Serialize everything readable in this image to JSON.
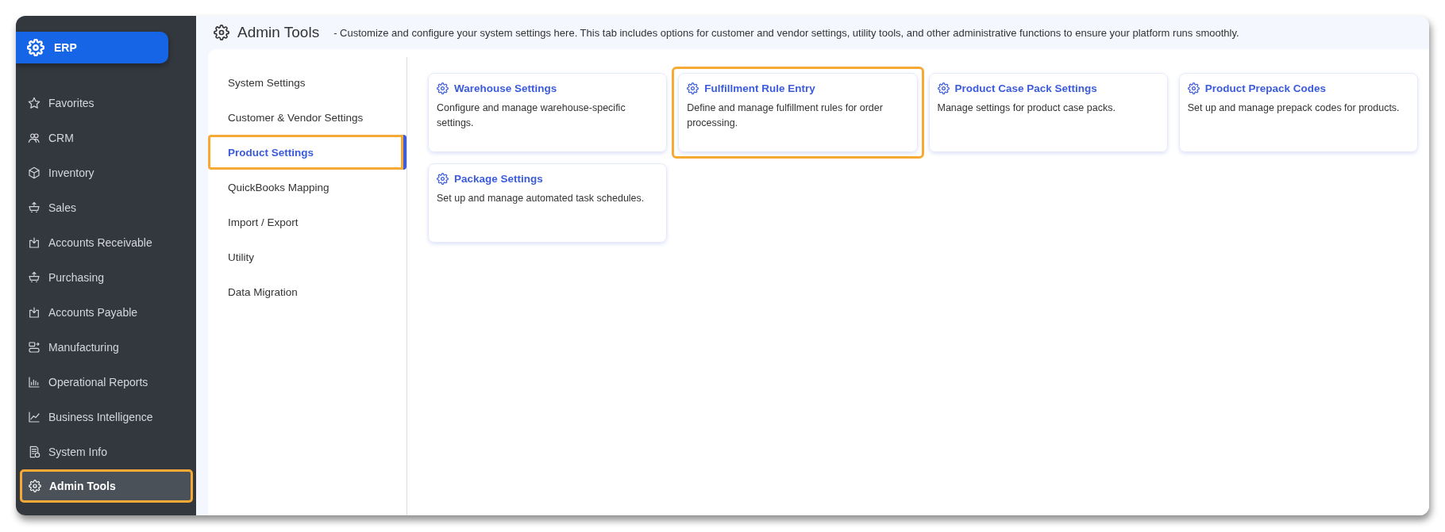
{
  "app": {
    "logo_text": "ERP"
  },
  "sidebar": {
    "items": [
      {
        "label": "Favorites",
        "selected": false,
        "highlighted": false
      },
      {
        "label": "CRM",
        "selected": false,
        "highlighted": false
      },
      {
        "label": "Inventory",
        "selected": false,
        "highlighted": false
      },
      {
        "label": "Sales",
        "selected": false,
        "highlighted": false
      },
      {
        "label": "Accounts Receivable",
        "selected": false,
        "highlighted": false
      },
      {
        "label": "Purchasing",
        "selected": false,
        "highlighted": false
      },
      {
        "label": "Accounts Payable",
        "selected": false,
        "highlighted": false
      },
      {
        "label": "Manufacturing",
        "selected": false,
        "highlighted": false
      },
      {
        "label": "Operational Reports",
        "selected": false,
        "highlighted": false
      },
      {
        "label": "Business Intelligence",
        "selected": false,
        "highlighted": false
      },
      {
        "label": "System Info",
        "selected": false,
        "highlighted": false
      },
      {
        "label": "Admin Tools",
        "selected": true,
        "highlighted": true
      }
    ]
  },
  "header": {
    "title": "Admin Tools",
    "description": "- Customize and configure your system settings here. This tab includes options for customer and vendor settings, utility tools, and other administrative functions to ensure your platform runs smoothly."
  },
  "tabs": [
    {
      "label": "System Settings",
      "selected": false,
      "highlighted": false
    },
    {
      "label": "Customer & Vendor Settings",
      "selected": false,
      "highlighted": false
    },
    {
      "label": "Product Settings",
      "selected": true,
      "highlighted": true
    },
    {
      "label": "QuickBooks Mapping",
      "selected": false,
      "highlighted": false
    },
    {
      "label": "Import / Export",
      "selected": false,
      "highlighted": false
    },
    {
      "label": "Utility",
      "selected": false,
      "highlighted": false
    },
    {
      "label": "Data Migration",
      "selected": false,
      "highlighted": false
    }
  ],
  "cards": [
    {
      "title": "Warehouse Settings",
      "description": "Configure and manage warehouse-specific settings.",
      "highlighted": false
    },
    {
      "title": "Fulfillment Rule Entry",
      "description": "Define and manage fulfillment rules for order processing.",
      "highlighted": true
    },
    {
      "title": "Product Case Pack Settings",
      "description": "Manage settings for product case packs.",
      "highlighted": false
    },
    {
      "title": "Product Prepack Codes",
      "description": "Set up and manage prepack codes for products.",
      "highlighted": false
    },
    {
      "title": "Package Settings",
      "description": "Set up and manage automated task schedules.",
      "highlighted": false
    }
  ]
}
